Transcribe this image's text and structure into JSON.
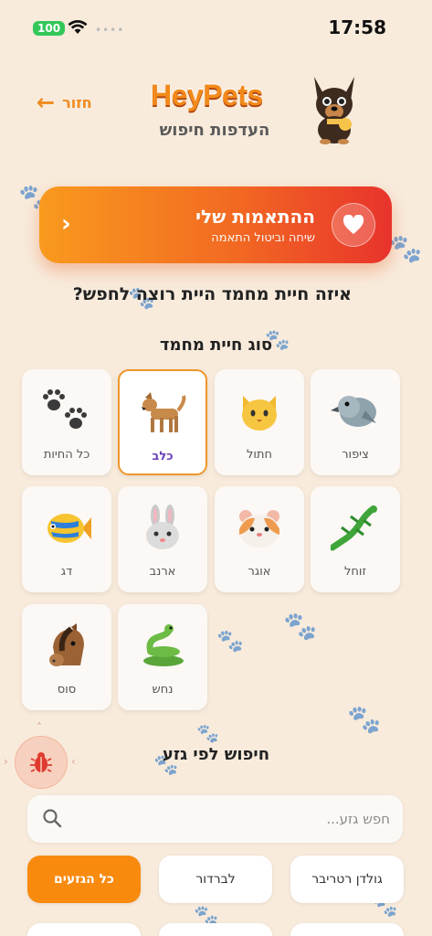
{
  "status_bar": {
    "time": "17:58",
    "battery": "100"
  },
  "header": {
    "back_label": "חזור",
    "brand": "HeyPets",
    "subtitle": "העדפות חיפוש"
  },
  "matches_card": {
    "title": "ההתאמות שלי",
    "subtitle": "שיחה וביטול התאמה"
  },
  "question": "איזה חיית מחמד היית רוצה לחפש?",
  "pet_type_section": {
    "title": "סוג חיית מחמד",
    "selected": "כלב",
    "options": [
      {
        "label": "ציפור",
        "icon": "bird-icon"
      },
      {
        "label": "חתול",
        "icon": "cat-face-icon"
      },
      {
        "label": "כלב",
        "icon": "dog-icon"
      },
      {
        "label": "כל החיות",
        "icon": "paw-prints-icon"
      },
      {
        "label": "זוחל",
        "icon": "lizard-icon"
      },
      {
        "label": "אוגר",
        "icon": "hamster-icon"
      },
      {
        "label": "ארנב",
        "icon": "rabbit-face-icon"
      },
      {
        "label": "דג",
        "icon": "tropical-fish-icon"
      },
      {
        "label": "נחש",
        "icon": "snake-icon"
      },
      {
        "label": "סוס",
        "icon": "horse-face-icon"
      }
    ]
  },
  "breed_section": {
    "title": "חיפוש לפי גזע",
    "search_placeholder": "חפש גזע...",
    "chips": [
      {
        "label": "גולדן רטריבר",
        "active": false
      },
      {
        "label": "לברדור",
        "active": false
      },
      {
        "label": "כל הגזעים",
        "active": true
      }
    ]
  },
  "colors": {
    "accent": "#f88a0e",
    "background": "#f8ebdc",
    "selected_label": "#6a3fb8"
  }
}
